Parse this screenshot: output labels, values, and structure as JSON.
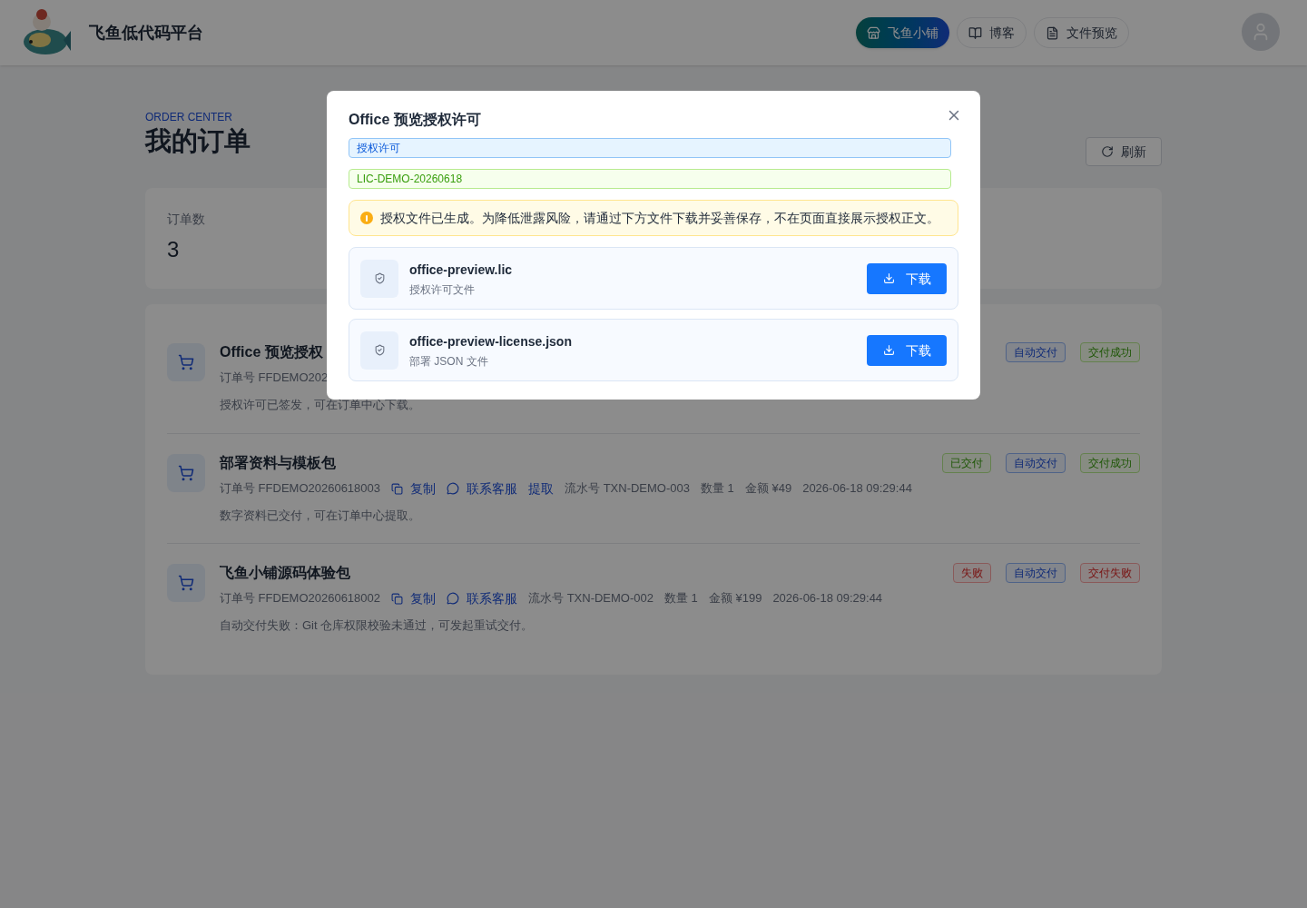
{
  "header": {
    "brand": "飞鱼低代码平台",
    "nav": [
      {
        "label": "飞鱼小铺",
        "selected": true
      },
      {
        "label": "博客",
        "selected": false
      },
      {
        "label": "文件预览",
        "selected": false
      }
    ]
  },
  "page": {
    "eyebrow": "ORDER CENTER",
    "title": "我的订单",
    "refresh": "刷新"
  },
  "stats": [
    {
      "label": "订单数",
      "value": "3"
    }
  ],
  "orders": [
    {
      "title": "Office 预览授权",
      "order_no": "订单号 FFDEMO202",
      "note": "授权许可已签发，可在订单中心下载。",
      "tags": [
        {
          "label": "自动交付",
          "kind": "info"
        },
        {
          "label": "交付成功",
          "kind": "success"
        }
      ]
    },
    {
      "title": "部署资料与模板包",
      "order_no": "订单号 FFDEMO20260618003",
      "meta": [
        {
          "kind": "copy",
          "label": "复制"
        },
        {
          "kind": "service",
          "label": "联系客服"
        },
        {
          "kind": "link",
          "label": "提取"
        },
        {
          "kind": "text",
          "label": "流水号 TXN-DEMO-003"
        },
        {
          "kind": "text",
          "label": "数量 1"
        },
        {
          "kind": "text",
          "label": "金额 ¥49"
        },
        {
          "kind": "text",
          "label": "2026-06-18 09:29:44"
        }
      ],
      "note": "数字资料已交付，可在订单中心提取。",
      "tags": [
        {
          "label": "已交付",
          "kind": "success"
        },
        {
          "label": "自动交付",
          "kind": "info"
        },
        {
          "label": "交付成功",
          "kind": "success"
        }
      ]
    },
    {
      "title": "飞鱼小铺源码体验包",
      "order_no": "订单号 FFDEMO20260618002",
      "meta": [
        {
          "kind": "copy",
          "label": "复制"
        },
        {
          "kind": "service",
          "label": "联系客服"
        },
        {
          "kind": "text",
          "label": "流水号 TXN-DEMO-002"
        },
        {
          "kind": "text",
          "label": "数量 1"
        },
        {
          "kind": "text",
          "label": "金额 ¥199"
        },
        {
          "kind": "text",
          "label": "2026-06-18 09:29:44"
        }
      ],
      "note": "自动交付失败：Git 仓库权限校验未通过，可发起重试交付。",
      "tags": [
        {
          "label": "失败",
          "kind": "error"
        },
        {
          "label": "自动交付",
          "kind": "info"
        },
        {
          "label": "交付失败",
          "kind": "error"
        }
      ]
    }
  ],
  "modal": {
    "title": "Office 预览授权许可",
    "tag": "授权许可",
    "license": "LIC-DEMO-20260618",
    "warning": "授权文件已生成。为降低泄露风险，请通过下方文件下载并妥善保存，不在页面直接展示授权正文。",
    "files": [
      {
        "name": "office-preview.lic",
        "desc": "授权许可文件",
        "action": "下载"
      },
      {
        "name": "office-preview-license.json",
        "desc": "部署 JSON 文件",
        "action": "下载"
      }
    ]
  }
}
